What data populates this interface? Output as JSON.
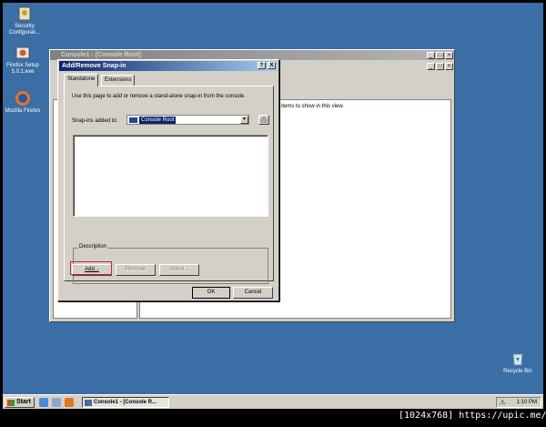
{
  "desktop": {
    "icons": [
      {
        "label": "Security Configurati..."
      },
      {
        "label": "Firefox Setup 5.0.1.exe"
      },
      {
        "label": "Mozilla Firefox"
      },
      {
        "label": "Recycle Bin"
      }
    ]
  },
  "console": {
    "title": "Console1 - [Console Root]",
    "content_text": "items to show in this view."
  },
  "dialog": {
    "title": "Add/Remove Snap-in",
    "help_button": "?",
    "close_button": "X",
    "tabs": [
      {
        "label": "Standalone"
      },
      {
        "label": "Extensions"
      }
    ],
    "description": "Use this page to add or remove a stand-alone snap-in from the console.",
    "snapins_label": "Snap-ins added to:",
    "combo_value": "Console Root",
    "group_label": "Description",
    "buttons": {
      "add": "Add...",
      "remove": "Remove",
      "about": "About...",
      "ok": "OK",
      "cancel": "Cancel"
    }
  },
  "taskbar": {
    "start": "Start",
    "task_label": "Console1 - [Console R...",
    "clock": "1:10 PM"
  },
  "watermark": "[1024x768] https://upic.me/"
}
